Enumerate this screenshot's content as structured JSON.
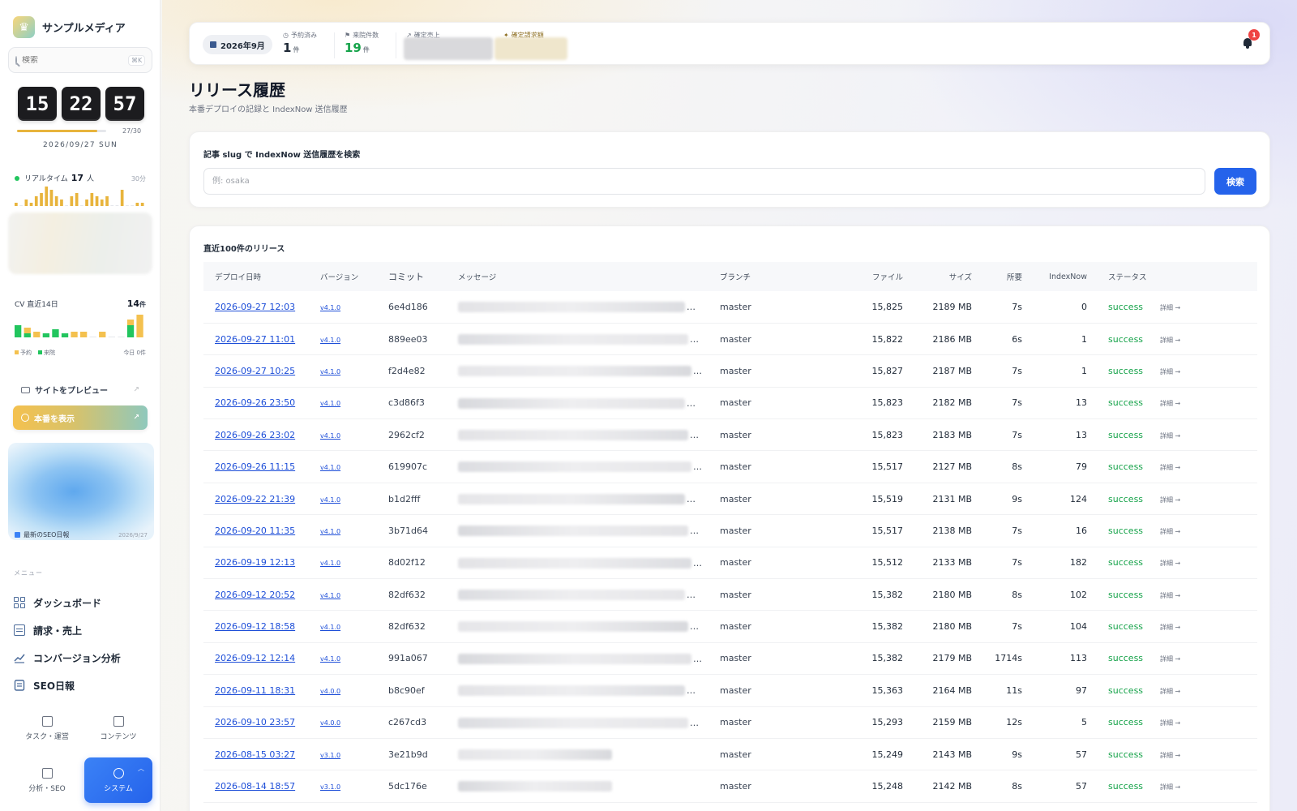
{
  "sidebar": {
    "brand": "サンプルメディア",
    "search": {
      "placeholder": "検索",
      "shortcut": "⌘K"
    },
    "clock": {
      "hours": "15",
      "minutes": "22",
      "seconds": "57"
    },
    "month_progress": {
      "text": "27/30",
      "fraction": 0.9
    },
    "date": "2026/09/27 SUN",
    "realtime": {
      "label": "リアルタイム",
      "count": "17",
      "unit": "人",
      "window": "30分",
      "bars": [
        1,
        0,
        2,
        1,
        3,
        4,
        6,
        5,
        3,
        2,
        0,
        3,
        4,
        0,
        2,
        4,
        3,
        2,
        3,
        0,
        0,
        5,
        0,
        0,
        1,
        1
      ]
    },
    "cv": {
      "label": "CV 直近14日",
      "count": "14",
      "unit": "件",
      "legend_reserve": "予約",
      "legend_visit": "来院",
      "today": "今日 0件",
      "reserve": [
        0,
        1,
        1,
        0,
        0,
        0,
        1,
        1,
        0,
        1,
        0,
        0,
        1,
        4
      ],
      "visit": [
        3,
        1,
        0,
        1,
        2,
        1,
        0,
        0,
        0,
        0,
        0,
        0,
        3,
        0
      ]
    },
    "preview_label": "サイトをプレビュー",
    "production_label": "本番を表示",
    "seo_report": {
      "label": "最新のSEO日報",
      "date": "2026/9/27"
    },
    "menu_title": "メニュー",
    "menu": [
      {
        "label": "ダッシュボード",
        "icon": "grid-icon"
      },
      {
        "label": "請求・売上",
        "icon": "receipt-icon"
      },
      {
        "label": "コンバージョン分析",
        "icon": "trend-icon"
      },
      {
        "label": "SEO日報",
        "icon": "report-icon"
      }
    ],
    "bottom_nav": [
      {
        "label": "タスク・運営",
        "icon": "board-icon"
      },
      {
        "label": "コンテンツ",
        "icon": "document-icon"
      },
      {
        "label": "分析・SEO",
        "icon": "bar-chart-icon"
      },
      {
        "label": "システム",
        "icon": "gear-icon",
        "active": true
      }
    ]
  },
  "topbar": {
    "month": "2026年9月",
    "reserved": {
      "label": "予約済み",
      "value": "1",
      "unit": "件"
    },
    "visits": {
      "label": "来院件数",
      "value": "19",
      "unit": "件"
    },
    "sales_label": "確定売上",
    "billing_label": "確定請求額",
    "notifications": "1"
  },
  "page": {
    "title": "リリース履歴",
    "subtitle": "本番デプロイの記録と IndexNow 送信履歴"
  },
  "search": {
    "label": "記事 slug で IndexNow 送信履歴を検索",
    "placeholder": "例: osaka",
    "button": "検索"
  },
  "releases": {
    "title": "直近100件のリリース",
    "columns": [
      "デプロイ日時",
      "バージョン",
      "コミット",
      "メッセージ",
      "ブランチ",
      "ファイル",
      "サイズ",
      "所要",
      "IndexNow",
      "ステータス"
    ],
    "rows": [
      {
        "date": "2026-09-27 12:03",
        "version": "v4.1.0",
        "commit": "6e4d186",
        "branch": "master",
        "files": "15,825",
        "size": "2189 MB",
        "time": "7s",
        "indexnow": "0",
        "status": "success",
        "detail": "詳細 →"
      },
      {
        "date": "2026-09-27 11:01",
        "version": "v4.1.0",
        "commit": "889ee03",
        "branch": "master",
        "files": "15,822",
        "size": "2186 MB",
        "time": "6s",
        "indexnow": "1",
        "status": "success",
        "detail": "詳細 →"
      },
      {
        "date": "2026-09-27 10:25",
        "version": "v4.1.0",
        "commit": "f2d4e82",
        "branch": "master",
        "files": "15,827",
        "size": "2187 MB",
        "time": "7s",
        "indexnow": "1",
        "status": "success",
        "detail": "詳細 →"
      },
      {
        "date": "2026-09-26 23:50",
        "version": "v4.1.0",
        "commit": "c3d86f3",
        "branch": "master",
        "files": "15,823",
        "size": "2182 MB",
        "time": "7s",
        "indexnow": "13",
        "status": "success",
        "detail": "詳細 →"
      },
      {
        "date": "2026-09-26 23:02",
        "version": "v4.1.0",
        "commit": "2962cf2",
        "branch": "master",
        "files": "15,823",
        "size": "2183 MB",
        "time": "7s",
        "indexnow": "13",
        "status": "success",
        "detail": "詳細 →"
      },
      {
        "date": "2026-09-26 11:15",
        "version": "v4.1.0",
        "commit": "619907c",
        "branch": "master",
        "files": "15,517",
        "size": "2127 MB",
        "time": "8s",
        "indexnow": "79",
        "status": "success",
        "detail": "詳細 →"
      },
      {
        "date": "2026-09-22 21:39",
        "version": "v4.1.0",
        "commit": "b1d2fff",
        "branch": "master",
        "files": "15,519",
        "size": "2131 MB",
        "time": "9s",
        "indexnow": "124",
        "status": "success",
        "detail": "詳細 →"
      },
      {
        "date": "2026-09-20 11:35",
        "version": "v4.1.0",
        "commit": "3b71d64",
        "branch": "master",
        "files": "15,517",
        "size": "2138 MB",
        "time": "7s",
        "indexnow": "16",
        "status": "success",
        "detail": "詳細 →"
      },
      {
        "date": "2026-09-19 12:13",
        "version": "v4.1.0",
        "commit": "8d02f12",
        "branch": "master",
        "files": "15,512",
        "size": "2133 MB",
        "time": "7s",
        "indexnow": "182",
        "status": "success",
        "detail": "詳細 →"
      },
      {
        "date": "2026-09-12 20:52",
        "version": "v4.1.0",
        "commit": "82df632",
        "branch": "master",
        "files": "15,382",
        "size": "2180 MB",
        "time": "8s",
        "indexnow": "102",
        "status": "success",
        "detail": "詳細 →"
      },
      {
        "date": "2026-09-12 18:58",
        "version": "v4.1.0",
        "commit": "82df632",
        "branch": "master",
        "files": "15,382",
        "size": "2180 MB",
        "time": "7s",
        "indexnow": "104",
        "status": "success",
        "detail": "詳細 →"
      },
      {
        "date": "2026-09-12 12:14",
        "version": "v4.1.0",
        "commit": "991a067",
        "branch": "master",
        "files": "15,382",
        "size": "2179 MB",
        "time": "1714s",
        "indexnow": "113",
        "status": "success",
        "detail": "詳細 →"
      },
      {
        "date": "2026-09-11 18:31",
        "version": "v4.0.0",
        "commit": "b8c90ef",
        "branch": "master",
        "files": "15,363",
        "size": "2164 MB",
        "time": "11s",
        "indexnow": "97",
        "status": "success",
        "detail": "詳細 →"
      },
      {
        "date": "2026-09-10 23:57",
        "version": "v4.0.0",
        "commit": "c267cd3",
        "branch": "master",
        "files": "15,293",
        "size": "2159 MB",
        "time": "12s",
        "indexnow": "5",
        "status": "success",
        "detail": "詳細 →"
      },
      {
        "date": "2026-08-15 03:27",
        "version": "v3.1.0",
        "commit": "3e21b9d",
        "branch": "master",
        "files": "15,249",
        "size": "2143 MB",
        "time": "9s",
        "indexnow": "57",
        "status": "success",
        "detail": "詳細 →"
      },
      {
        "date": "2026-08-14 18:57",
        "version": "v3.1.0",
        "commit": "5dc176e",
        "branch": "master",
        "files": "15,248",
        "size": "2142 MB",
        "time": "8s",
        "indexnow": "57",
        "status": "success",
        "detail": "詳細 →"
      }
    ],
    "message_ellipsis": "…"
  },
  "colors": {
    "accent": "#2563eb",
    "success": "#16a34a",
    "gold": "#e8b43c",
    "visit_green": "#22c55e",
    "badge_red": "#ef4444"
  }
}
